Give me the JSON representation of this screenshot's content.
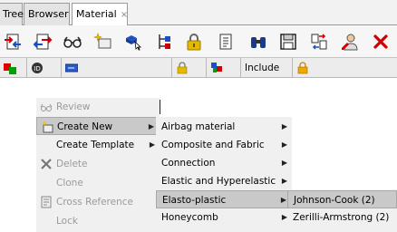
{
  "tabs": [
    {
      "label": "Tree"
    },
    {
      "label": "Browser"
    },
    {
      "label": "Material",
      "close": "×"
    }
  ],
  "toolbar_icons": [
    "import-icon",
    "export-icon",
    "review-glasses-icon",
    "new-item-icon",
    "select-icon",
    "hierarchy-icon",
    "lock-icon",
    "info-icon",
    "find-binoculars-icon",
    "save-icon",
    "compare-icon",
    "user-edit-icon",
    "delete-icon"
  ],
  "columns": {
    "include_label": "Include"
  },
  "context_menu": {
    "items": [
      {
        "label": "Review",
        "enabled": false,
        "icon": "glasses-icon",
        "submenu": false
      },
      {
        "label": "Create New",
        "enabled": true,
        "icon": "create-new-icon",
        "submenu": true,
        "highlighted": true
      },
      {
        "label": "Create Template",
        "enabled": true,
        "icon": "",
        "submenu": true
      },
      {
        "label": "Delete",
        "enabled": false,
        "icon": "delete-x-icon",
        "submenu": false
      },
      {
        "label": "Clone",
        "enabled": false,
        "icon": "",
        "submenu": false
      },
      {
        "label": "Cross Reference",
        "enabled": false,
        "icon": "cross-reference-icon",
        "submenu": false
      },
      {
        "label": "Lock",
        "enabled": false,
        "icon": "",
        "submenu": false
      }
    ]
  },
  "submenu_create_new": {
    "items": [
      {
        "label": "Airbag material",
        "submenu": true
      },
      {
        "label": "Composite and Fabric",
        "submenu": true
      },
      {
        "label": "Connection",
        "submenu": true
      },
      {
        "label": "Elastic and Hyperelastic",
        "submenu": true
      },
      {
        "label": "Elasto-plastic",
        "submenu": true,
        "highlighted": true
      },
      {
        "label": "Honeycomb",
        "submenu": true
      }
    ]
  },
  "submenu_elasto_plastic": {
    "items": [
      {
        "label": "Johnson-Cook (2)",
        "highlighted": true
      },
      {
        "label": "Zerilli-Armstrong (2)"
      }
    ]
  },
  "arrow_glyph": "▶",
  "colors": {
    "highlight": "#c9c9c9",
    "menu_bg": "#f0f0f0",
    "disabled_text": "#9a9a9a"
  }
}
